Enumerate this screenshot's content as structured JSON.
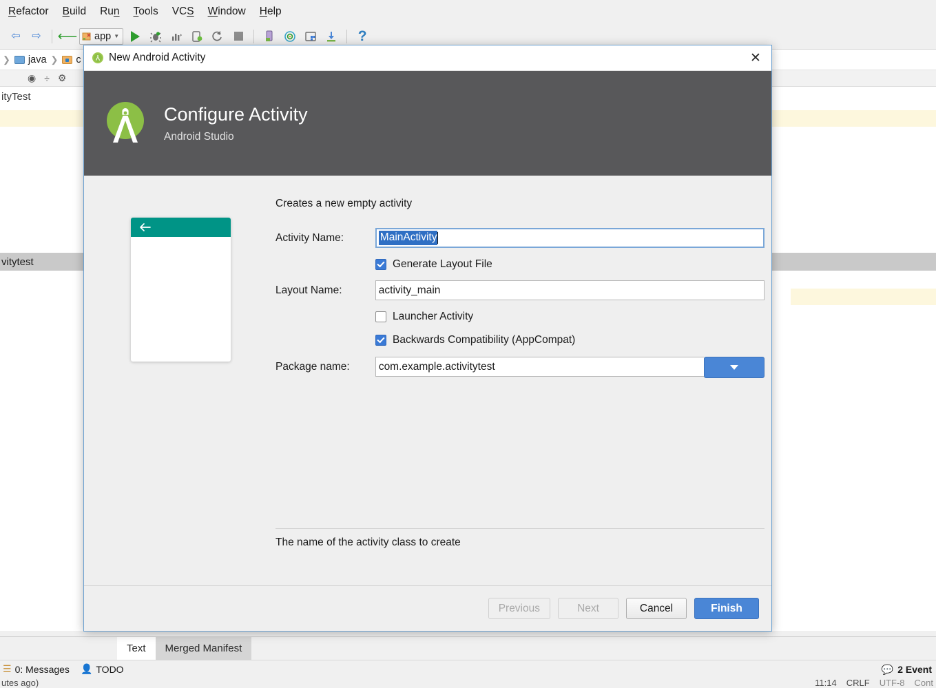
{
  "ide": {
    "menubar": [
      {
        "label": "Refactor",
        "mnemonic": "R"
      },
      {
        "label": "Build",
        "mnemonic": "B"
      },
      {
        "label": "Run",
        "mnemonic": "n"
      },
      {
        "label": "Tools",
        "mnemonic": "T"
      },
      {
        "label": "VCS",
        "mnemonic": "S"
      },
      {
        "label": "Window",
        "mnemonic": "W"
      },
      {
        "label": "Help",
        "mnemonic": "H"
      }
    ],
    "toolbar": {
      "run_config_label": "app",
      "help_label": "?",
      "icons": [
        "back-arrow-icon",
        "forward-arrow-icon",
        "revert-icon",
        "run-config-icon",
        "run-icon",
        "debug-icon",
        "profile-icon",
        "apply-changes-icon",
        "rerun-icon",
        "stop-icon",
        "avd-manager-icon",
        "sdk-manager-icon",
        "layout-inspector-icon",
        "sync-gradle-icon",
        "help-icon"
      ]
    },
    "breadcrumb": [
      {
        "label": "java",
        "icon": "folder-icon-blue"
      },
      {
        "label": "c",
        "icon": "folder-icon-orange"
      }
    ],
    "editor": {
      "top_text": "ityTest",
      "selected_row_text": "vitytest"
    },
    "tabs": [
      {
        "label": "Text",
        "active": true
      },
      {
        "label": "Merged Manifest",
        "active": false
      }
    ],
    "status": {
      "messages": "0: Messages",
      "messages_mnemonic": "0",
      "todo": "TODO",
      "event_log": "2 Event",
      "time": "11:14",
      "line_sep": "CRLF",
      "encoding": "UTF-8",
      "context": "Cont",
      "left_fragment": "utes ago)"
    }
  },
  "dialog": {
    "title": "New Android Activity",
    "close_label": "✕",
    "header": {
      "title": "Configure Activity",
      "subtitle": "Android Studio",
      "bg_color": "#58585a",
      "logo_color": "#9ec84f"
    },
    "description": "Creates a new empty activity",
    "preview": {
      "appbar_color": "#009486",
      "back_icon": "back-arrow-icon"
    },
    "fields": {
      "activity_name_label": "Activity Name:",
      "activity_name_value": "MainActivity",
      "layout_name_label": "Layout Name:",
      "layout_name_value": "activity_main",
      "package_name_label": "Package name:",
      "package_name_value": "com.example.activitytest"
    },
    "checkboxes": [
      {
        "label": "Generate Layout File",
        "checked": true
      },
      {
        "label": "Launcher Activity",
        "checked": false
      },
      {
        "label": "Backwards Compatibility (AppCompat)",
        "checked": true
      }
    ],
    "hint": "The name of the activity class to create",
    "buttons": [
      {
        "label": "Previous",
        "state": "disabled"
      },
      {
        "label": "Next",
        "state": "disabled"
      },
      {
        "label": "Cancel",
        "state": "normal"
      },
      {
        "label": "Finish",
        "state": "primary"
      }
    ],
    "colors": {
      "selection": "#2f6fc4",
      "checkbox": "#3a7ad6",
      "primary_button": "#4a86d6"
    }
  }
}
